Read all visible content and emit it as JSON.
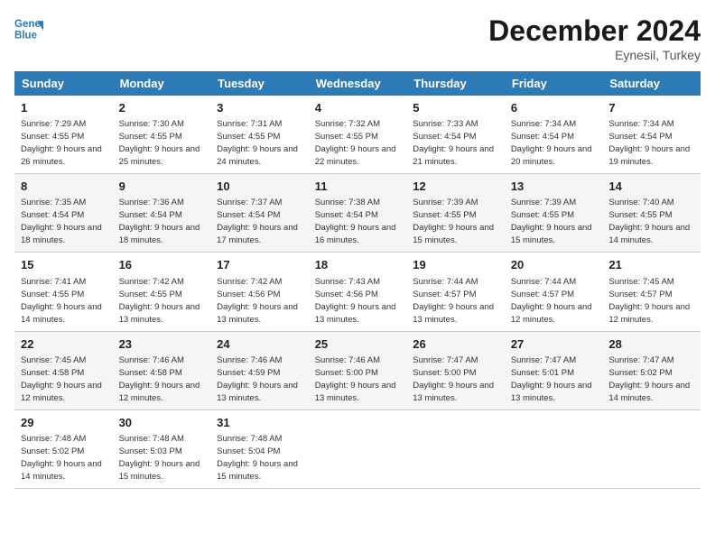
{
  "header": {
    "logo_line1": "General",
    "logo_line2": "Blue",
    "month": "December 2024",
    "location": "Eynesil, Turkey"
  },
  "days_of_week": [
    "Sunday",
    "Monday",
    "Tuesday",
    "Wednesday",
    "Thursday",
    "Friday",
    "Saturday"
  ],
  "weeks": [
    [
      {
        "num": "1",
        "rise": "7:29 AM",
        "set": "4:55 PM",
        "daylight": "9 hours and 26 minutes."
      },
      {
        "num": "2",
        "rise": "7:30 AM",
        "set": "4:55 PM",
        "daylight": "9 hours and 25 minutes."
      },
      {
        "num": "3",
        "rise": "7:31 AM",
        "set": "4:55 PM",
        "daylight": "9 hours and 24 minutes."
      },
      {
        "num": "4",
        "rise": "7:32 AM",
        "set": "4:55 PM",
        "daylight": "9 hours and 22 minutes."
      },
      {
        "num": "5",
        "rise": "7:33 AM",
        "set": "4:54 PM",
        "daylight": "9 hours and 21 minutes."
      },
      {
        "num": "6",
        "rise": "7:34 AM",
        "set": "4:54 PM",
        "daylight": "9 hours and 20 minutes."
      },
      {
        "num": "7",
        "rise": "7:34 AM",
        "set": "4:54 PM",
        "daylight": "9 hours and 19 minutes."
      }
    ],
    [
      {
        "num": "8",
        "rise": "7:35 AM",
        "set": "4:54 PM",
        "daylight": "9 hours and 18 minutes."
      },
      {
        "num": "9",
        "rise": "7:36 AM",
        "set": "4:54 PM",
        "daylight": "9 hours and 18 minutes."
      },
      {
        "num": "10",
        "rise": "7:37 AM",
        "set": "4:54 PM",
        "daylight": "9 hours and 17 minutes."
      },
      {
        "num": "11",
        "rise": "7:38 AM",
        "set": "4:54 PM",
        "daylight": "9 hours and 16 minutes."
      },
      {
        "num": "12",
        "rise": "7:39 AM",
        "set": "4:55 PM",
        "daylight": "9 hours and 15 minutes."
      },
      {
        "num": "13",
        "rise": "7:39 AM",
        "set": "4:55 PM",
        "daylight": "9 hours and 15 minutes."
      },
      {
        "num": "14",
        "rise": "7:40 AM",
        "set": "4:55 PM",
        "daylight": "9 hours and 14 minutes."
      }
    ],
    [
      {
        "num": "15",
        "rise": "7:41 AM",
        "set": "4:55 PM",
        "daylight": "9 hours and 14 minutes."
      },
      {
        "num": "16",
        "rise": "7:42 AM",
        "set": "4:55 PM",
        "daylight": "9 hours and 13 minutes."
      },
      {
        "num": "17",
        "rise": "7:42 AM",
        "set": "4:56 PM",
        "daylight": "9 hours and 13 minutes."
      },
      {
        "num": "18",
        "rise": "7:43 AM",
        "set": "4:56 PM",
        "daylight": "9 hours and 13 minutes."
      },
      {
        "num": "19",
        "rise": "7:44 AM",
        "set": "4:57 PM",
        "daylight": "9 hours and 13 minutes."
      },
      {
        "num": "20",
        "rise": "7:44 AM",
        "set": "4:57 PM",
        "daylight": "9 hours and 12 minutes."
      },
      {
        "num": "21",
        "rise": "7:45 AM",
        "set": "4:57 PM",
        "daylight": "9 hours and 12 minutes."
      }
    ],
    [
      {
        "num": "22",
        "rise": "7:45 AM",
        "set": "4:58 PM",
        "daylight": "9 hours and 12 minutes."
      },
      {
        "num": "23",
        "rise": "7:46 AM",
        "set": "4:58 PM",
        "daylight": "9 hours and 12 minutes."
      },
      {
        "num": "24",
        "rise": "7:46 AM",
        "set": "4:59 PM",
        "daylight": "9 hours and 13 minutes."
      },
      {
        "num": "25",
        "rise": "7:46 AM",
        "set": "5:00 PM",
        "daylight": "9 hours and 13 minutes."
      },
      {
        "num": "26",
        "rise": "7:47 AM",
        "set": "5:00 PM",
        "daylight": "9 hours and 13 minutes."
      },
      {
        "num": "27",
        "rise": "7:47 AM",
        "set": "5:01 PM",
        "daylight": "9 hours and 13 minutes."
      },
      {
        "num": "28",
        "rise": "7:47 AM",
        "set": "5:02 PM",
        "daylight": "9 hours and 14 minutes."
      }
    ],
    [
      {
        "num": "29",
        "rise": "7:48 AM",
        "set": "5:02 PM",
        "daylight": "9 hours and 14 minutes."
      },
      {
        "num": "30",
        "rise": "7:48 AM",
        "set": "5:03 PM",
        "daylight": "9 hours and 15 minutes."
      },
      {
        "num": "31",
        "rise": "7:48 AM",
        "set": "5:04 PM",
        "daylight": "9 hours and 15 minutes."
      },
      null,
      null,
      null,
      null
    ]
  ],
  "labels": {
    "sunrise": "Sunrise:",
    "sunset": "Sunset:",
    "daylight": "Daylight:"
  }
}
